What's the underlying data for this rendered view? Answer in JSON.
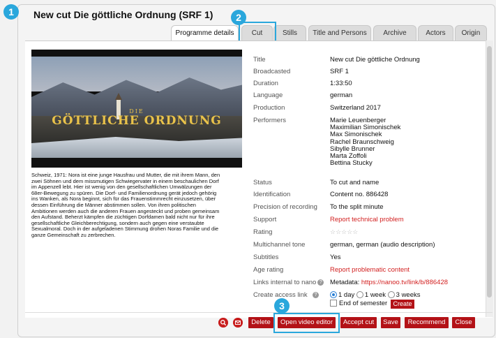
{
  "title": "New cut Die göttliche Ordnung (SRF 1)",
  "steps": [
    "1",
    "2",
    "3"
  ],
  "tabs": [
    "Programme details",
    "Cut",
    "Stills",
    "Title and Persons",
    "Archive",
    "Actors",
    "Origin"
  ],
  "video": {
    "title_small": "DIE",
    "title_big": "GÖTTLICHE ORDNUNG"
  },
  "description": [
    "Schweiz, 1971: Nora ist eine junge Hausfrau und Mutter, die mit ihrem Mann, den",
    "zwei Söhnen und dem missmutigen Schwiegervater in einem beschaulichen Dorf",
    "im Appenzell lebt. Hier ist wenig von den gesellschaftlichen Umwälzungen der",
    "68er-Bewegung zu spüren. Die Dorf- und Familienordnung gerät jedoch gehörig",
    "ins Wanken, als Nora beginnt, sich für das Frauenstimmrecht einzusetzen, über",
    "dessen Einführung die Männer abstimmen sollen. Von ihren politischen",
    "Ambitionen werden auch die anderen Frauen angesteckt und proben gemeinsam",
    "den Aufstand. Beherzt kämpfen die züchtigen Dorfdamen bald nicht nur für ihre",
    "gesellschaftliche Gleichberechtigung, sondern auch gegen eine verstaubte",
    "Sexualmoral. Doch in der aufgeladenen Stimmung drohen Noras Familie und die",
    "ganze Gemeinschaft zu zerbrechen."
  ],
  "meta": {
    "title_label": "Title",
    "title_value": "New cut Die göttliche Ordnung",
    "broadcasted_label": "Broadcasted",
    "broadcasted_value": "SRF 1",
    "duration_label": "Duration",
    "duration_value": "1:33:50",
    "language_label": "Language",
    "language_value": "german",
    "production_label": "Production",
    "production_value": "Switzerland 2017",
    "performers_label": "Performers",
    "performers": [
      "Marie Leuenberger",
      "Maximilian Simonischek",
      "Max Simonischek",
      "Rachel Braunschweig",
      "Sibylle Brunner",
      "Marta Zoffoli",
      "Bettina Stucky"
    ],
    "status_label": "Status",
    "status_value": "To cut and name",
    "identification_label": "Identification",
    "identification_value": "Content no. 886428",
    "precision_label": "Precision of recording",
    "precision_value": "To the split minute",
    "support_label": "Support",
    "support_value": "Report technical problem",
    "rating_label": "Rating",
    "rating_stars": "☆☆☆☆☆",
    "multichannel_label": "Multichannel tone",
    "multichannel_value": "german, german (audio description)",
    "subtitles_label": "Subtitles",
    "subtitles_value": "Yes",
    "age_label": "Age rating",
    "age_value": "Report problematic content",
    "links_label": "Links internal to nano",
    "links_prefix": "Metadata:",
    "links_url": "https://nanoo.tv/link/b/886428",
    "access_label": "Create access link",
    "access_options": [
      "1 day",
      "1 week",
      "3 weeks"
    ],
    "end_semester": "End of semester",
    "create_label": "Create"
  },
  "buttons": {
    "delete": "Delete",
    "open_editor": "Open video editor",
    "accept": "Accept cut",
    "save": "Save",
    "recommend": "Recommend",
    "close": "Close"
  }
}
